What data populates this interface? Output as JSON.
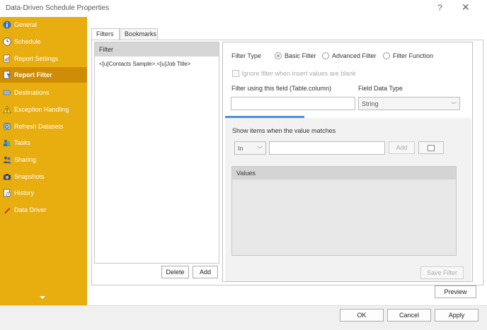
{
  "window": {
    "title": "Data-Driven Schedule Properties",
    "help_glyph": "?",
    "close_glyph": "✕"
  },
  "sidebar": {
    "items": [
      {
        "label": "General",
        "icon": "info-icon",
        "active": false
      },
      {
        "label": "Schedule",
        "icon": "clock-icon",
        "active": false
      },
      {
        "label": "Report Settings",
        "icon": "report-settings-icon",
        "active": false
      },
      {
        "label": "Report Filter",
        "icon": "report-filter-icon",
        "active": true
      },
      {
        "label": "Destinations",
        "icon": "destinations-icon",
        "active": false
      },
      {
        "label": "Exception Handling",
        "icon": "warning-icon",
        "active": false
      },
      {
        "label": "Refresh Datasets",
        "icon": "refresh-icon",
        "active": false
      },
      {
        "label": "Tasks",
        "icon": "tasks-icon",
        "active": false
      },
      {
        "label": "Sharing",
        "icon": "sharing-icon",
        "active": false
      },
      {
        "label": "Snapshots",
        "icon": "snapshot-icon",
        "active": false
      },
      {
        "label": "History",
        "icon": "history-icon",
        "active": false
      },
      {
        "label": "Data Driver",
        "icon": "data-driver-icon",
        "active": false
      }
    ]
  },
  "tabs": [
    {
      "label": "Filters"
    },
    {
      "label": "Bookmarks"
    }
  ],
  "filter_list": {
    "header": "Filter",
    "rows": [
      "<[u]Contacts Sample>.<[u]Job Title>"
    ],
    "delete_label": "Delete",
    "add_label": "Add"
  },
  "editor": {
    "filter_type_label": "Filter Type",
    "filter_types": [
      {
        "label": "Basic Filter",
        "checked": true
      },
      {
        "label": "Advanced Filter",
        "checked": false
      },
      {
        "label": "Filter Function",
        "checked": false
      }
    ],
    "ignore_label": "Ignore filter when insert values are blank",
    "field_label": "Filter using this field (Table.column)",
    "field_value": "",
    "data_type_label": "Field Data Type",
    "data_type_value": "String",
    "match_label": "Show items when the value matches",
    "operator_value": "In",
    "match_value": "",
    "add_label": "Add",
    "values_header": "Values",
    "save_filter_label": "Save Filter"
  },
  "preview_label": "Preview",
  "footer": {
    "ok_label": "OK",
    "cancel_label": "Cancel",
    "apply_label": "Apply"
  },
  "colors": {
    "sidebar": "#e8ad0e",
    "sidebar_active": "#cf8d05",
    "accent": "#4a8fd8"
  }
}
